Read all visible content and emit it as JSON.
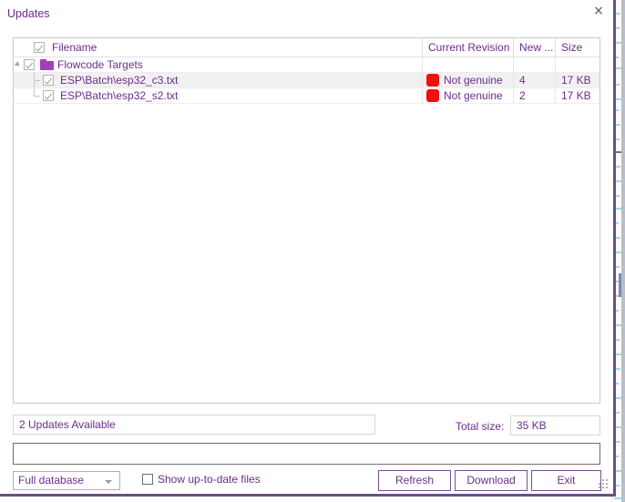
{
  "window": {
    "title": "Updates",
    "close_label": "×"
  },
  "file_list": {
    "columns": [
      {
        "key": "filename",
        "label": "Filename"
      },
      {
        "key": "current_revision",
        "label": "Current Revision"
      },
      {
        "key": "new_revision",
        "label": "New ..."
      },
      {
        "key": "size",
        "label": "Size"
      }
    ],
    "group": {
      "label": "Flowcode Targets",
      "checked": true,
      "expanded": true,
      "icon": "folder-icon"
    },
    "rows": [
      {
        "filename": "ESP\\Batch\\esp32_c3.txt",
        "checked": true,
        "status_color": "#f20f0f",
        "current_revision": "Not genuine",
        "new_revision": "4",
        "size": "17 KB"
      },
      {
        "filename": "ESP\\Batch\\esp32_s2.txt",
        "checked": true,
        "status_color": "#f20f0f",
        "current_revision": "Not genuine",
        "new_revision": "2",
        "size": "17 KB"
      }
    ]
  },
  "footer": {
    "updates_status": "2 Updates Available",
    "total_size_label": "Total size:",
    "total_size_value": "35 KB",
    "progress_value": "",
    "database_select": "Full database",
    "show_uptodate_label": "Show up-to-date files",
    "show_uptodate_checked": false,
    "buttons": {
      "refresh": "Refresh",
      "download": "Download",
      "exit": "Exit"
    }
  },
  "theme": {
    "accent": "#6b2d8e",
    "folder": "#a13fb5",
    "status_red": "#f20f0f",
    "dialog_border": "#6a5080"
  }
}
